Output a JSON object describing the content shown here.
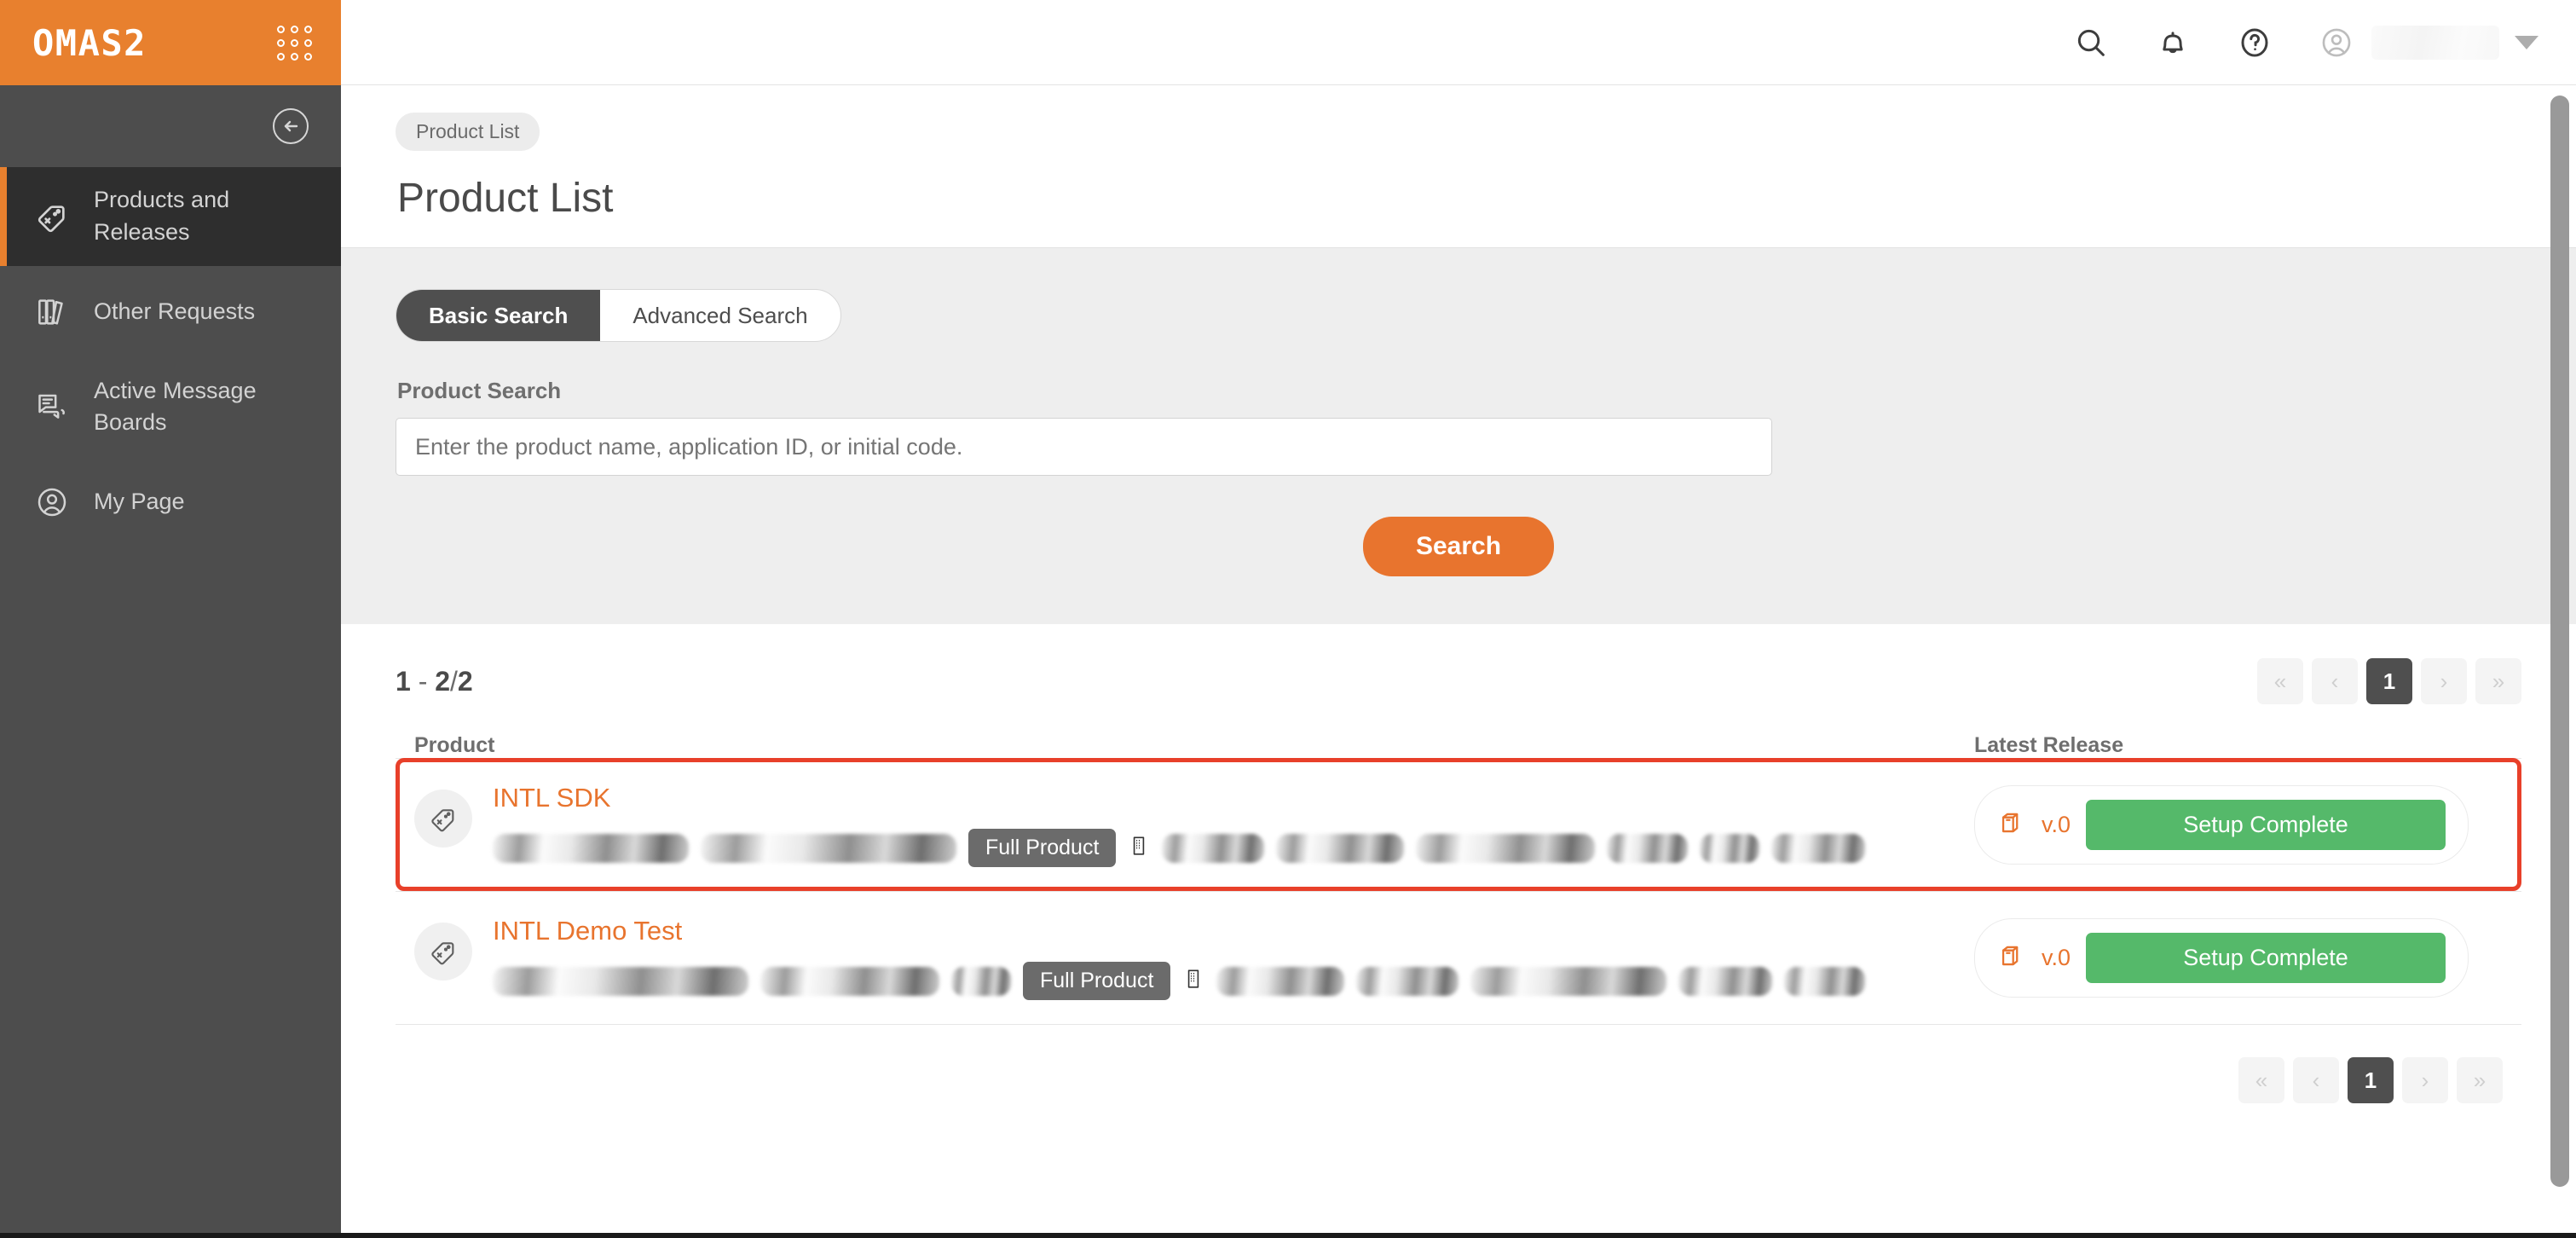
{
  "app": {
    "logo": "OMAS2",
    "apps_grid_icon": "apps-grid-icon",
    "collapse_icon": "arrow-left-circle-icon"
  },
  "sidebar": {
    "items": [
      {
        "label": "Products and\nReleases",
        "icon": "tag-icon",
        "active": true
      },
      {
        "label": "Other Requests",
        "icon": "binders-icon",
        "active": false
      },
      {
        "label": "Active Message\nBoards",
        "icon": "chat-bubbles-icon",
        "active": false
      },
      {
        "label": "My Page",
        "icon": "user-circle-icon",
        "active": false
      }
    ]
  },
  "topbar": {
    "icons": [
      "search-icon",
      "bell-icon",
      "help-circle-icon",
      "user-circle-icon"
    ],
    "user_name": "",
    "caret": "chevron-down-icon"
  },
  "page": {
    "breadcrumb": "Product List",
    "title": "Product List"
  },
  "search": {
    "tabs": [
      {
        "label": "Basic Search",
        "active": true
      },
      {
        "label": "Advanced Search",
        "active": false
      }
    ],
    "field_label": "Product Search",
    "placeholder": "Enter the product name, application ID, or initial code.",
    "value": "",
    "button_label": "Search"
  },
  "results": {
    "count_text": "1 - 2 / 2",
    "count_from": "1",
    "count_dash": "-",
    "count_to": "2",
    "count_sep": "/",
    "count_total": "2",
    "columns": {
      "product": "Product",
      "latest_release": "Latest Release"
    },
    "pagination": {
      "first": "«",
      "prev": "‹",
      "current": "1",
      "next": "›",
      "last": "»"
    },
    "rows": [
      {
        "name": "INTL SDK",
        "icon": "tag-icon",
        "badge": "Full Product",
        "company_icon": "building-icon",
        "version": "v.0",
        "release_icon": "package-box-icon",
        "status": "Setup Complete",
        "highlighted": true
      },
      {
        "name": "INTL Demo Test",
        "icon": "tag-icon",
        "badge": "Full Product",
        "company_icon": "building-icon",
        "version": "v.0",
        "release_icon": "package-box-icon",
        "status": "Setup Complete",
        "highlighted": false
      }
    ]
  },
  "colors": {
    "brand_orange": "#E8802E",
    "accent_orange": "#E8742E",
    "highlight_red": "#E8402A",
    "status_green": "#55B96A",
    "sidebar_gray": "#4D4D4D",
    "sidebar_active": "#2E2E2E",
    "panel_gray": "#EEEEEE"
  }
}
